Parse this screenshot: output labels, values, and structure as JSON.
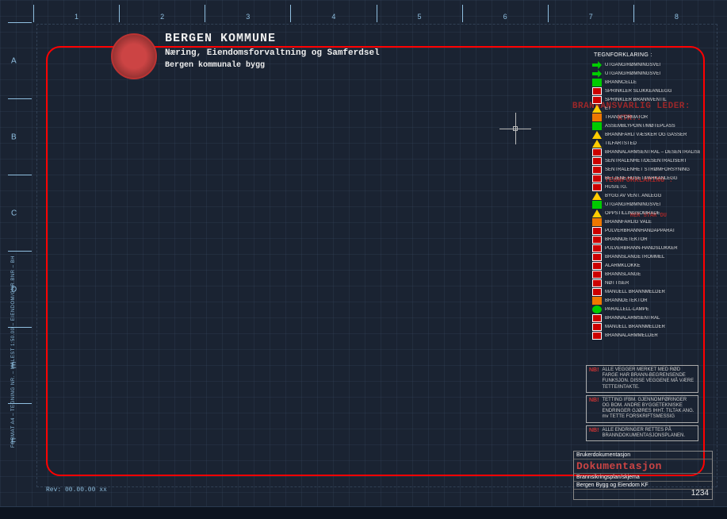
{
  "header": {
    "title": "BERGEN KOMMUNE",
    "subtitle": "Næring, Eiendomsforvaltning og Samferdsel",
    "dept": "Bergen kommunale bygg"
  },
  "ruler_top": [
    "1",
    "2",
    "3",
    "4",
    "5",
    "6",
    "7",
    "8"
  ],
  "ruler_left": [
    "A",
    "B",
    "C",
    "D",
    "E",
    "F"
  ],
  "side_label": "FORMAT A4 – TEGNING NR. – MÅLEST 1:50.00 – EIENDOM/GNR.BNR – BH",
  "legend": {
    "title": "TEGNFORKLARING :",
    "items": [
      {
        "ic": "arrow-green",
        "t": "UTGANG/RØMNINGSVEI"
      },
      {
        "ic": "arrow-green",
        "t": "UTGANG/RØMNINGSVEI"
      },
      {
        "ic": "sq-green",
        "t": "BRANNCELLE"
      },
      {
        "ic": "sq-red",
        "t": "SPRINKLER SLUKKEANLEGG"
      },
      {
        "ic": "sq-red",
        "t": "SPRINKLER BRANNVENTIL"
      },
      {
        "ic": "tri",
        "t": "ET"
      },
      {
        "ic": "sq-orange",
        "t": "TRANSFORMATOR"
      },
      {
        "ic": "sq-green",
        "t": "ASSEMBLYPOINT/MØTEPLASS"
      },
      {
        "ic": "tri",
        "t": "BRANNFARLI VÆSKER OG GASSER"
      },
      {
        "ic": "tri",
        "t": "TILFARTSTED"
      },
      {
        "ic": "sq-red",
        "t": "BRANNALARMSENTRAL – DESENTRALISERT"
      },
      {
        "ic": "sq-red",
        "t": "SENTRALENHET/DESENTRALISERT"
      },
      {
        "ic": "sq-red",
        "t": "SENTRALENHET STRØMFORSYNING"
      },
      {
        "ic": "sq-red",
        "t": "BETJENE HUSET/PARKANLEGG"
      },
      {
        "ic": "sq-red",
        "t": "HUS/ETG."
      },
      {
        "ic": "tri",
        "t": "BYGG AV VENT. ANLEGG"
      },
      {
        "ic": "sq-green",
        "t": "UTGANG/RØMNINGSVEI"
      },
      {
        "ic": "tri",
        "t": "OPPSTILLINGSOMRÅDE"
      },
      {
        "ic": "sq-orange",
        "t": "BRANNFARLIG VALE"
      },
      {
        "ic": "sq-red",
        "t": "PULVERBRANNHÅNDAPPARAT"
      },
      {
        "ic": "sq-red",
        "t": "BRANNDETEKTOR"
      },
      {
        "ic": "sq-red",
        "t": "PULVERBRANN-HÅNDSLUKKER"
      },
      {
        "ic": "sq-red",
        "t": "BRANNSLANGETROMMEL"
      },
      {
        "ic": "sq-red",
        "t": "ALARMKLOKKE"
      },
      {
        "ic": "sq-red",
        "t": "BRANNSLANGE"
      },
      {
        "ic": "sq-red",
        "t": "NØTTISER"
      },
      {
        "ic": "sq-red",
        "t": "MANUELL BRANNMELDER"
      },
      {
        "ic": "sq-orange",
        "t": "BRANNDETEKTOR"
      },
      {
        "ic": "circ",
        "t": "PARALLELL-LAMPE"
      },
      {
        "ic": "sq-red",
        "t": "BRANNALARMSENTRAL"
      },
      {
        "ic": "sq-red",
        "t": "MANUELL BRANNMELDER"
      },
      {
        "ic": "sq-red",
        "t": "BRANNALARMMELDER"
      }
    ]
  },
  "stamps": {
    "s1": "BRANNANSVARLIG LEDER:",
    "s2": "KTR.:",
    "s3": "TEGNFORKLARING :",
    "s4": "HER STÅR DU"
  },
  "nb": {
    "block1_label": "NB!",
    "block1": "ALLE VEGGER MERKET MED RØD FARGE HAR BRANN-BEGRENSENDE FUNKSJON. DISSE VEGGENE MÅ VÆRE TETTE/INTAKTE.",
    "block2_label": "NB!",
    "block2": "TETTING IFBM. GJENNOMFØRINGER OG BOM. ANDRE BYGGETEKNISKE ENDRINGER GJØRES IHHT. TILTAK ANG. mv TETTE FORSKRIFTSMESSIG",
    "block3_label": "NB!",
    "block3": "ALLE ENDRINGER RETTES PÅ BRANNDOKUMENTASJONSPLANEN."
  },
  "titleblock": {
    "row1": "Brukerdokumentasjon",
    "big1": "Dokumentasjon",
    "small": "Brannsikringsplan/skjema",
    "row2": "Bergen Bygg og Eiendom KF",
    "num": "1234"
  },
  "rev": "Rev: 00.00.00   xx"
}
